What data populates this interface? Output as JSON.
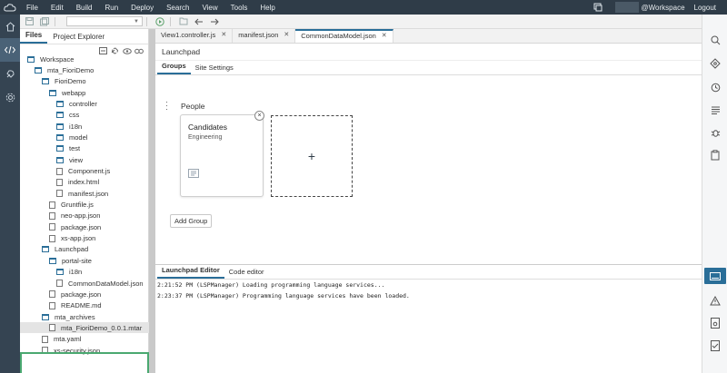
{
  "menubar": {
    "items": [
      "File",
      "Edit",
      "Build",
      "Run",
      "Deploy",
      "Search",
      "View",
      "Tools",
      "Help"
    ],
    "workspace": "@Workspace",
    "logout": "Logout"
  },
  "explorer": {
    "tabs": [
      "Files",
      "Project Explorer"
    ],
    "tree": [
      {
        "label": "Workspace",
        "type": "folder",
        "indent": 0
      },
      {
        "label": "mta_FioriDemo",
        "type": "folder",
        "indent": 1
      },
      {
        "label": "FioriDemo",
        "type": "folder",
        "indent": 2
      },
      {
        "label": "webapp",
        "type": "folder",
        "indent": 3
      },
      {
        "label": "controller",
        "type": "folder",
        "indent": 4
      },
      {
        "label": "css",
        "type": "folder",
        "indent": 4
      },
      {
        "label": "i18n",
        "type": "folder",
        "indent": 4
      },
      {
        "label": "model",
        "type": "folder",
        "indent": 4
      },
      {
        "label": "test",
        "type": "folder",
        "indent": 4
      },
      {
        "label": "view",
        "type": "folder",
        "indent": 4
      },
      {
        "label": "Component.js",
        "type": "file",
        "indent": 4
      },
      {
        "label": "index.html",
        "type": "file",
        "indent": 4
      },
      {
        "label": "manifest.json",
        "type": "file",
        "indent": 4
      },
      {
        "label": "Gruntfile.js",
        "type": "file",
        "indent": 3
      },
      {
        "label": "neo-app.json",
        "type": "file",
        "indent": 3
      },
      {
        "label": "package.json",
        "type": "file",
        "indent": 3
      },
      {
        "label": "xs-app.json",
        "type": "file",
        "indent": 3
      },
      {
        "label": "Launchpad",
        "type": "folder",
        "indent": 2
      },
      {
        "label": "portal-site",
        "type": "folder",
        "indent": 3
      },
      {
        "label": "i18n",
        "type": "folder",
        "indent": 4
      },
      {
        "label": "CommonDataModel.json",
        "type": "file",
        "indent": 4
      },
      {
        "label": "package.json",
        "type": "file",
        "indent": 3
      },
      {
        "label": "README.md",
        "type": "file",
        "indent": 3
      },
      {
        "label": "mta_archives",
        "type": "folder",
        "indent": 2
      },
      {
        "label": "mta_FioriDemo_0.0.1.mtar",
        "type": "file",
        "indent": 3,
        "selected": true
      },
      {
        "label": "mta.yaml",
        "type": "file",
        "indent": 2
      },
      {
        "label": "xs-security.json",
        "type": "file",
        "indent": 2
      }
    ]
  },
  "editor": {
    "tabs": [
      {
        "label": "View1.controller.js",
        "active": false
      },
      {
        "label": "manifest.json",
        "active": false
      },
      {
        "label": "CommonDataModel.json",
        "active": true
      }
    ],
    "title": "Launchpad",
    "subtabs": [
      "Groups",
      "Site Settings"
    ],
    "group_name": "People",
    "tile": {
      "title": "Candidates",
      "subtitle": "Engineering",
      "close": "×"
    },
    "add_tile": "+",
    "add_group": "Add Group"
  },
  "console": {
    "tabs": [
      "Launchpad Editor",
      "Code editor"
    ],
    "lines": [
      "2:21:52 PM (LSPManager) Loading programming language services...",
      "2:23:37 PM (LSPManager) Programming language services have been loaded."
    ]
  },
  "colors": {
    "accent": "#2a6e98",
    "menubar": "#2f3c48",
    "highlight": "#4aa870"
  }
}
